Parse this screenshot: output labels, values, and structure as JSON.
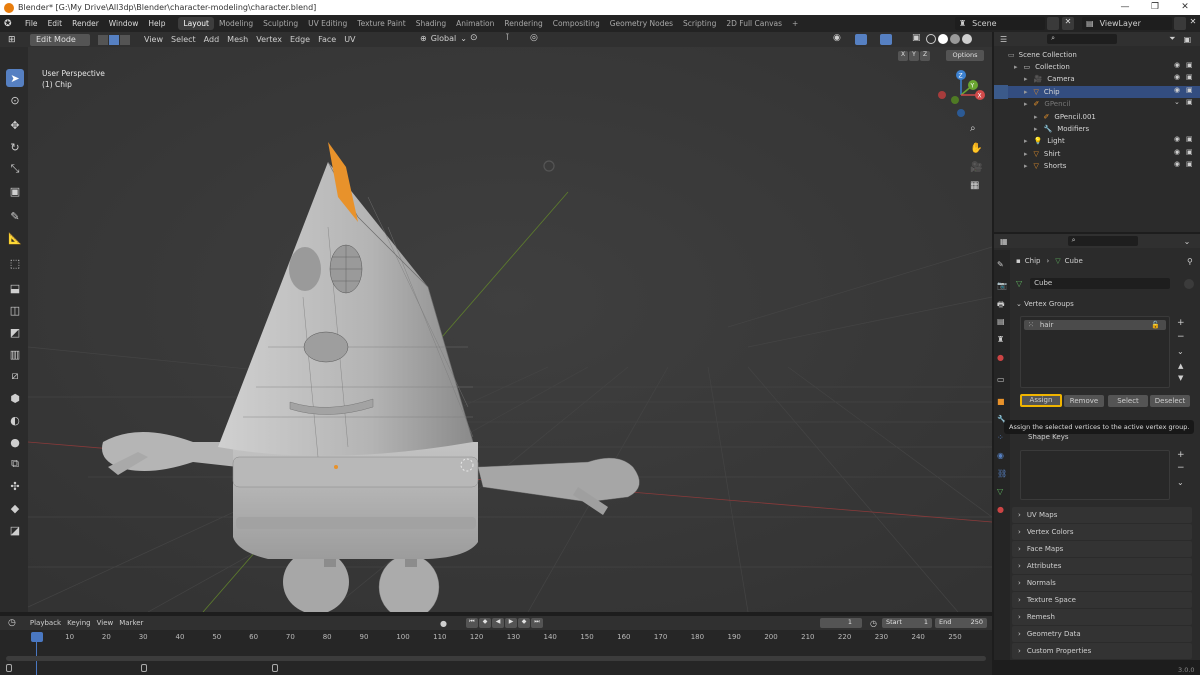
{
  "window": {
    "title": "Blender* [G:\\My Drive\\All3dp\\Blender\\character-modeling\\character.blend]",
    "version": "3.0.0"
  },
  "menu": [
    "File",
    "Edit",
    "Render",
    "Window",
    "Help"
  ],
  "workspaces": [
    "Layout",
    "Modeling",
    "Sculpting",
    "UV Editing",
    "Texture Paint",
    "Shading",
    "Animation",
    "Rendering",
    "Compositing",
    "Geometry Nodes",
    "Scripting",
    "2D Full Canvas"
  ],
  "active_workspace": "Layout",
  "scene": {
    "name": "Scene",
    "view_layer": "ViewLayer"
  },
  "viewport_header": {
    "mode": "Edit Mode",
    "menus": [
      "View",
      "Select",
      "Add",
      "Mesh",
      "Vertex",
      "Edge",
      "Face",
      "UV"
    ],
    "transform_orientation": "Global",
    "axes": [
      "X",
      "Y",
      "Z"
    ],
    "options": "Options"
  },
  "viewport": {
    "view_name": "User Perspective",
    "object_name": "(1) Chip"
  },
  "gizmo_axes": [
    "Z",
    "Y",
    "X"
  ],
  "outliner": {
    "root": "Scene Collection",
    "items": [
      {
        "label": "Collection",
        "indent": 0
      },
      {
        "label": "Camera",
        "indent": 1
      },
      {
        "label": "Chip",
        "indent": 1
      },
      {
        "label": "GPencil",
        "indent": 1
      },
      {
        "label": "GPencil.001",
        "indent": 2
      },
      {
        "label": "Modifiers",
        "indent": 2
      },
      {
        "label": "Light",
        "indent": 1
      },
      {
        "label": "Shirt",
        "indent": 1
      },
      {
        "label": "Shorts",
        "indent": 1
      }
    ]
  },
  "properties": {
    "breadcrumb_object": "Chip",
    "breadcrumb_data": "Cube",
    "data_name": "Cube",
    "vertex_groups_label": "Vertex Groups",
    "vertex_group_item": "hair",
    "buttons": {
      "assign": "Assign",
      "remove": "Remove",
      "select": "Select",
      "deselect": "Deselect"
    },
    "tooltip": "Assign the selected vertices to the active vertex group.",
    "shape_keys_label": "Shape Keys",
    "sections": [
      "UV Maps",
      "Vertex Colors",
      "Face Maps",
      "Attributes",
      "Normals",
      "Texture Space",
      "Remesh",
      "Geometry Data",
      "Custom Properties"
    ]
  },
  "timeline": {
    "menus": [
      "Playback",
      "Keying",
      "View",
      "Marker"
    ],
    "current_frame": "1",
    "start_label": "Start",
    "start": "1",
    "end_label": "End",
    "end": "250",
    "ticks": [
      "1",
      "10",
      "20",
      "30",
      "40",
      "50",
      "60",
      "70",
      "80",
      "90",
      "100",
      "110",
      "120",
      "130",
      "140",
      "150",
      "160",
      "170",
      "180",
      "190",
      "200",
      "210",
      "220",
      "230",
      "240",
      "250"
    ]
  },
  "colors": {
    "accent": "#5680c2",
    "selection": "#e8922b",
    "highlight_button": "#f0b400"
  }
}
